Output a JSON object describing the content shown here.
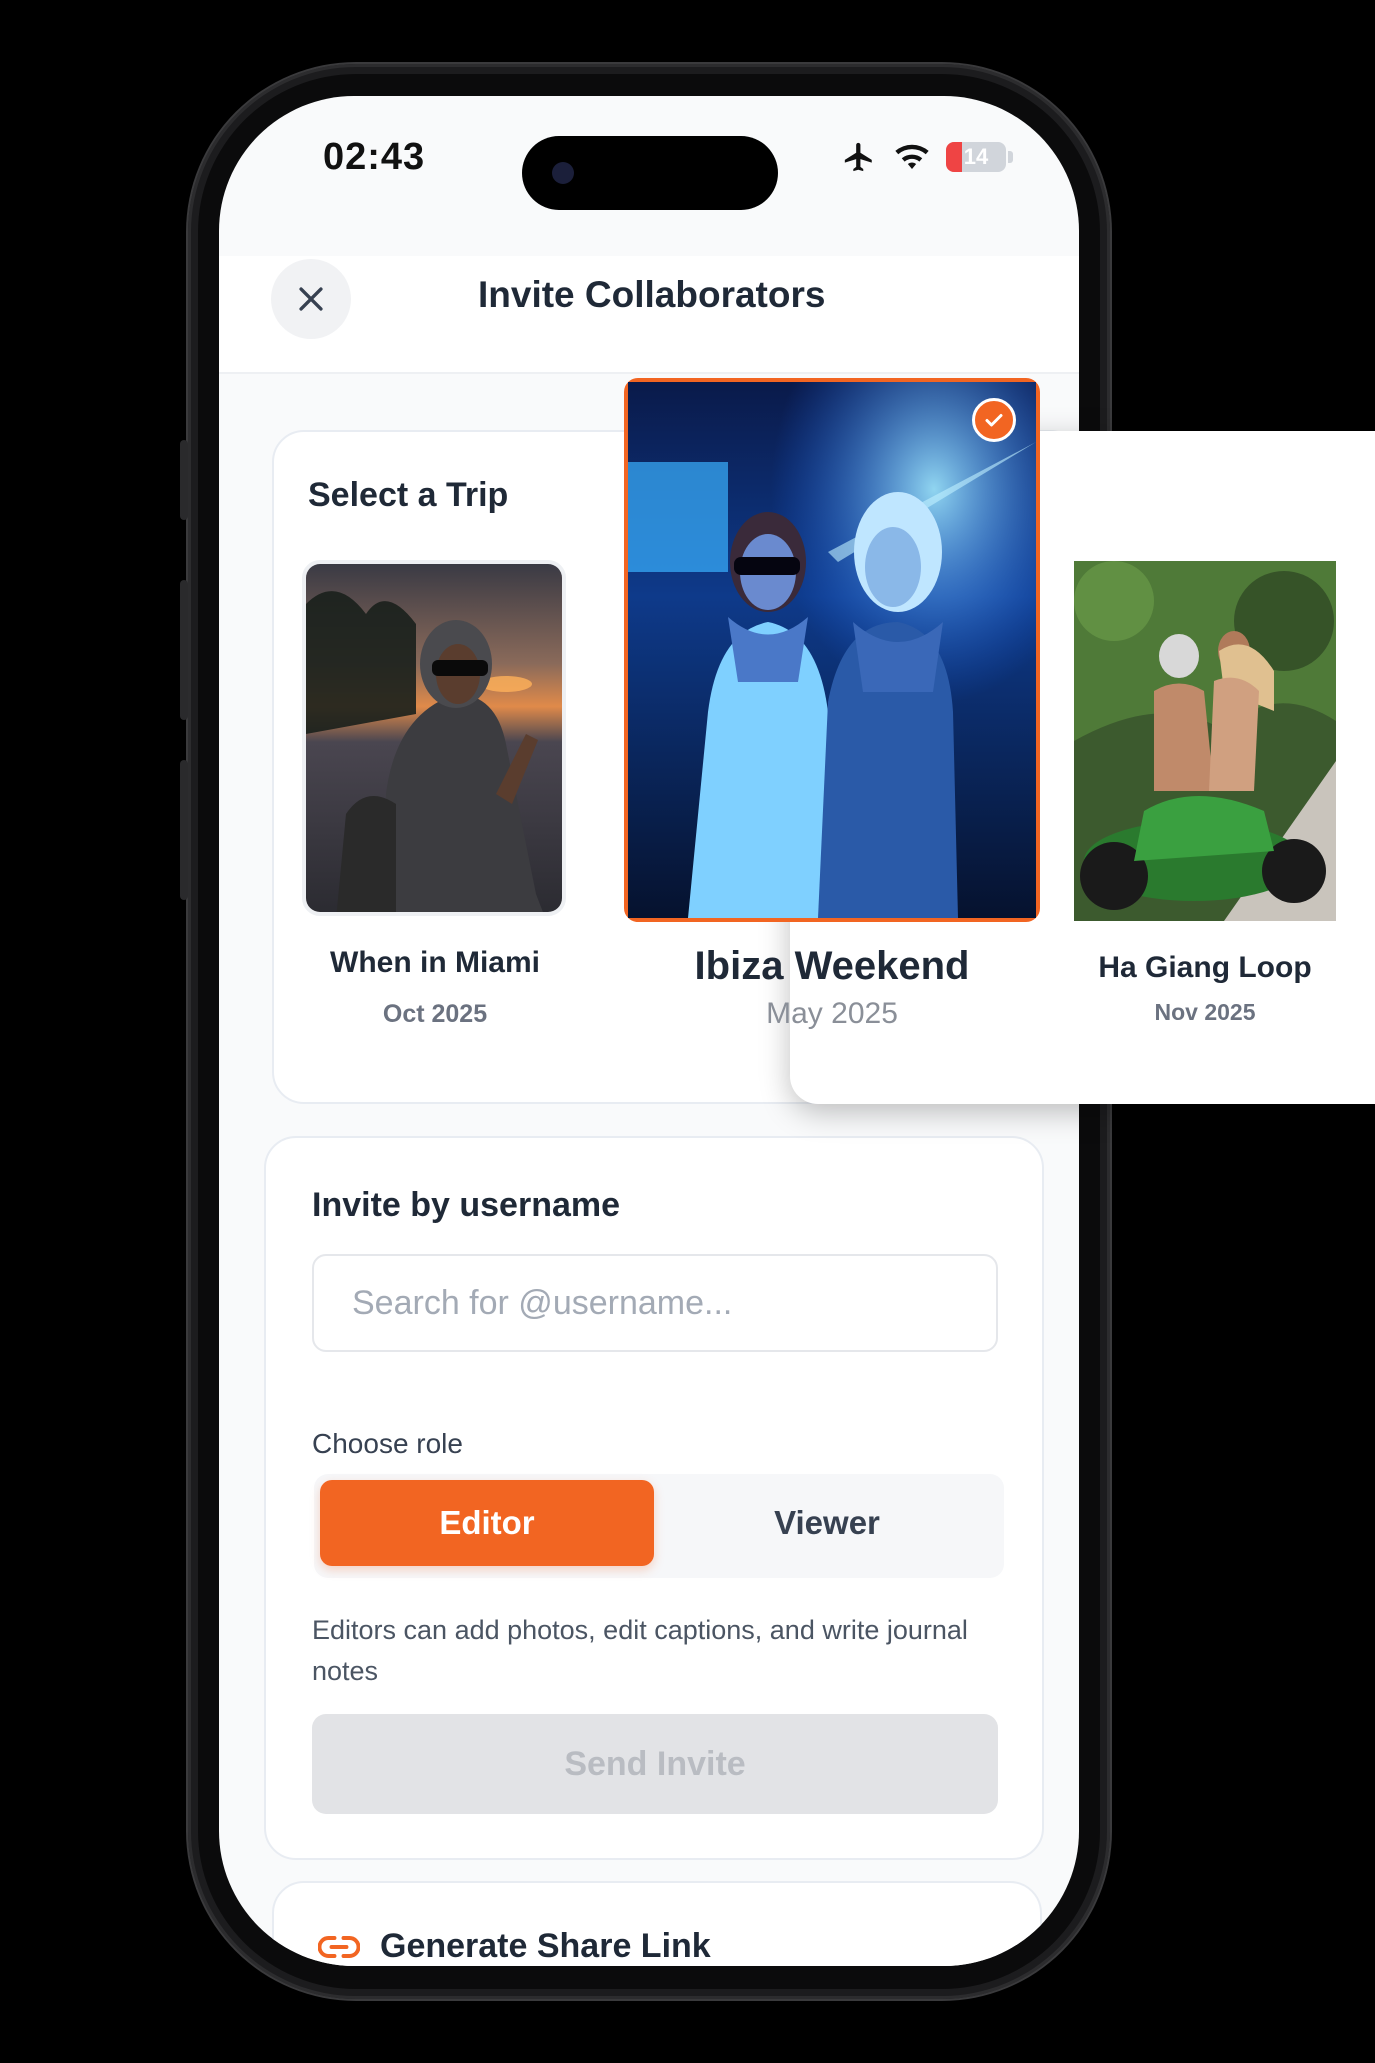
{
  "status_bar": {
    "time": "02:43",
    "battery": "14"
  },
  "header": {
    "title": "Invite Collaborators"
  },
  "select_trip": {
    "title": "Select a Trip",
    "trips": [
      {
        "name": "When in Miami",
        "date": "Oct 2025",
        "selected": false
      },
      {
        "name": "Ibiza Weekend",
        "date": "May 2025",
        "selected": true
      },
      {
        "name": "Ha Giang Loop",
        "date": "Nov 2025",
        "selected": false
      }
    ]
  },
  "invite": {
    "title": "Invite by username",
    "search_placeholder": "Search for @username...",
    "search_value": "",
    "role_label": "Choose role",
    "roles": [
      "Editor",
      "Viewer"
    ],
    "selected_role": "Editor",
    "role_description": "Editors can add photos, edit captions, and write journal notes",
    "send_label": "Send Invite"
  },
  "share": {
    "label": "Generate Share Link"
  },
  "colors": {
    "accent": "#f26522",
    "background": "#000000",
    "card": "#ffffff"
  }
}
